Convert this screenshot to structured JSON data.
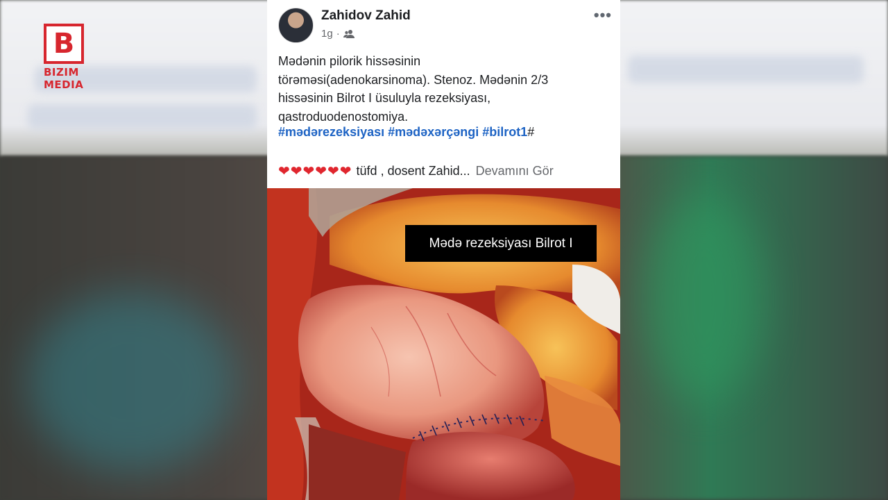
{
  "logo": {
    "letter": "B",
    "line1": "BIZIM",
    "line2": "MEDIA",
    "brand_color": "#d7262e"
  },
  "post": {
    "author": "Zahidov Zahid",
    "time": "1g",
    "separator": "·",
    "audience_icon": "friends-icon",
    "more_icon": "more-options-icon",
    "more_label": "•••",
    "body_lines": [
      "Mədənin pilorik hissəsinin",
      "törəməsi(adenokarsinoma). Stenoz. Mədənin 2/3",
      "hissəsinin Bilrot I üsuluyla rezeksiyası,",
      "qastroduodenostomiya."
    ],
    "hashtags": [
      "#mədərezeksiyası",
      "#mədəxərçəngi",
      "#bilrot1"
    ],
    "hashtag_trailing": "#",
    "hearts": "❤❤❤❤❤❤",
    "snippet": "tüfd , dosent Zahid...",
    "see_more": "Devamını Gör",
    "link_color": "#1d63c4"
  },
  "photo": {
    "caption": "Mədə rezeksiyası Bilrot I",
    "content": "surgical-photo"
  }
}
